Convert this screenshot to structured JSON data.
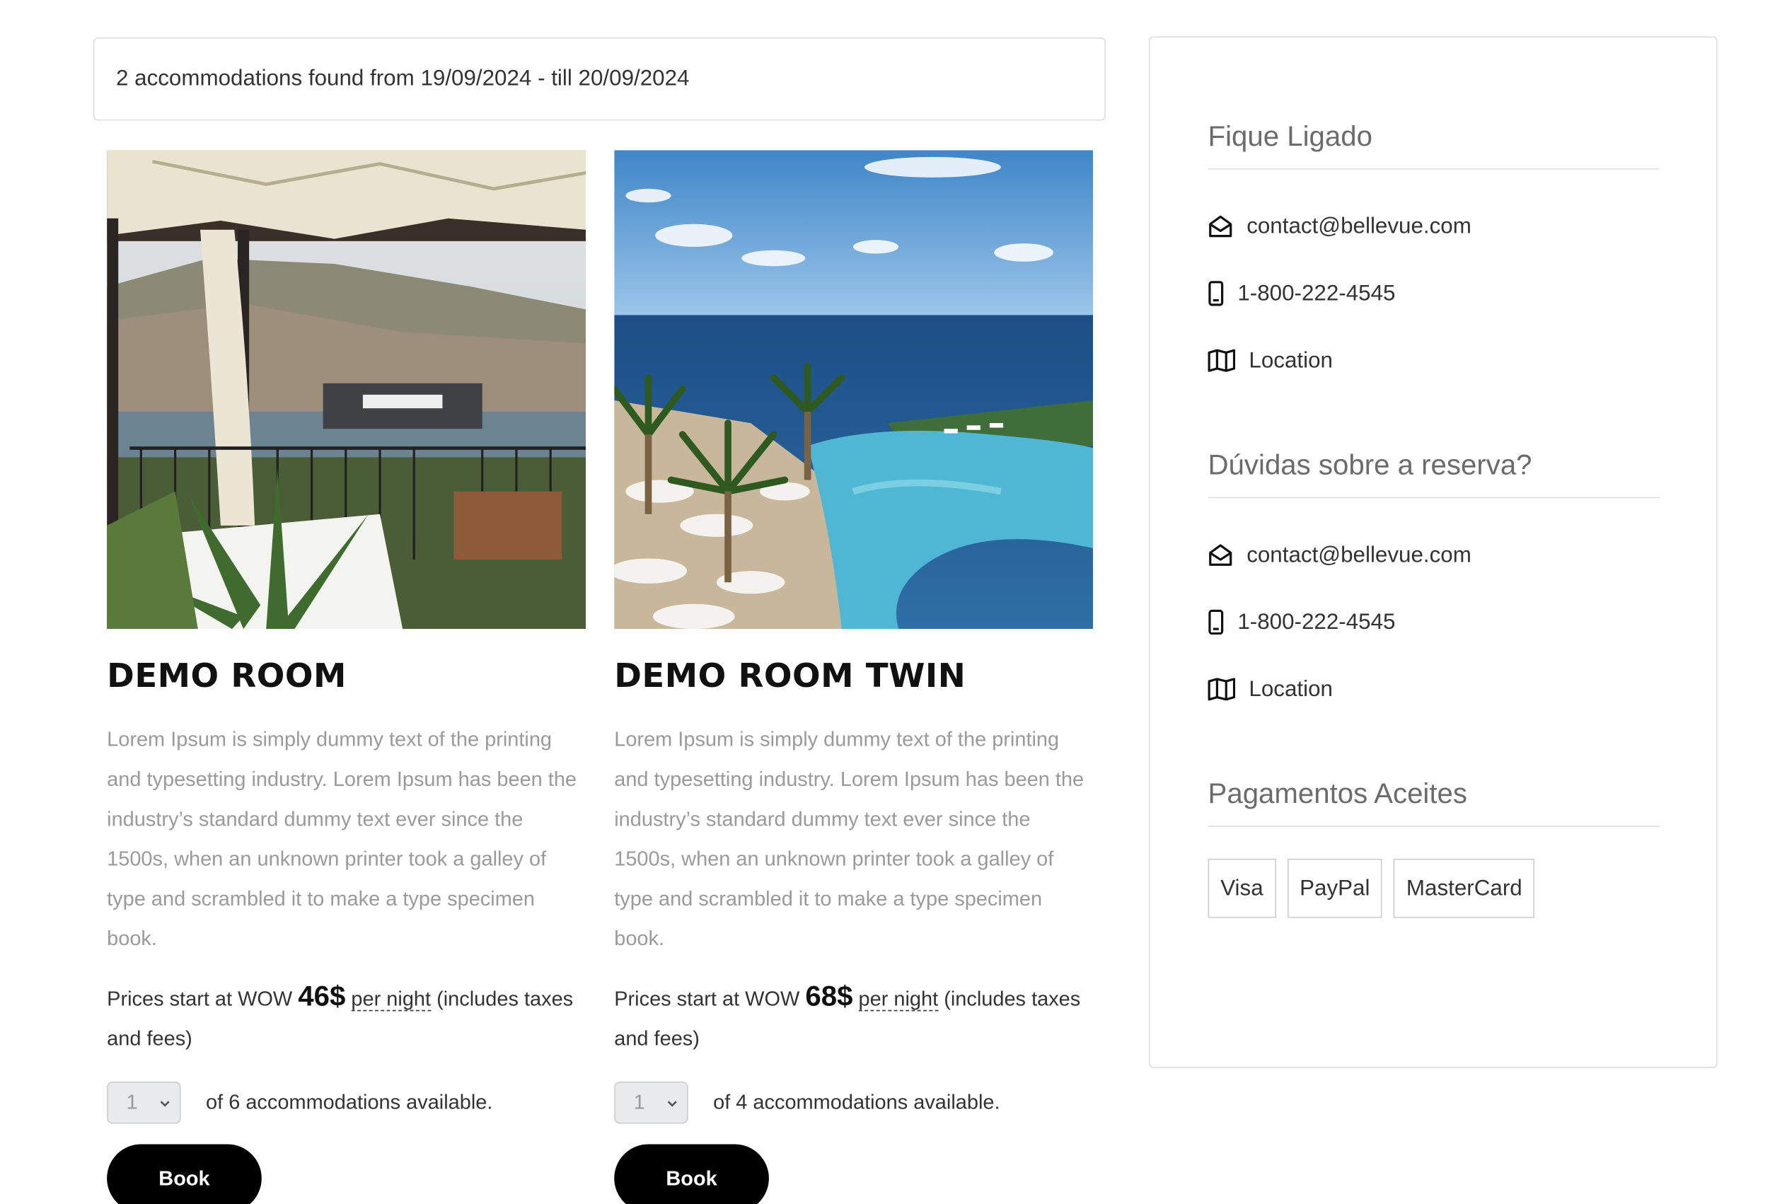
{
  "results": {
    "summary": "2 accommodations found from 19/09/2024 - till 20/09/2024"
  },
  "rooms": [
    {
      "title": "DEMO ROOM",
      "description": "Lorem Ipsum is simply dummy text of the printing and typesetting industry. Lorem Ipsum has been the industry’s standard dummy text ever since the 1500s, when an unknown printer took a galley of type and scrambled it to make a type specimen book.",
      "price_prefix": "Prices start at WOW ",
      "price": "46$",
      "per_night": "per night",
      "price_suffix": " (includes taxes and fees)",
      "qty": "1",
      "availability": "of 6 accommodations available.",
      "book_label": "Book"
    },
    {
      "title": "DEMO ROOM TWIN",
      "description": "Lorem Ipsum is simply dummy text of the printing and typesetting industry. Lorem Ipsum has been the industry’s standard dummy text ever since the 1500s, when an unknown printer took a galley of type and scrambled it to make a type specimen book.",
      "price_prefix": "Prices start at WOW ",
      "price": "68$",
      "per_night": "per night",
      "price_suffix": " (includes taxes and fees)",
      "qty": "1",
      "availability": "of 4 accommodations available.",
      "book_label": "Book"
    }
  ],
  "sidebar": {
    "stay_connected": {
      "heading": "Fique Ligado",
      "email": "contact@bellevue.com",
      "phone": "1-800-222-4545",
      "location": "Location"
    },
    "booking_questions": {
      "heading": "Dúvidas sobre a reserva?",
      "email": "contact@bellevue.com",
      "phone": "1-800-222-4545",
      "location": "Location"
    },
    "payments": {
      "heading": "Pagamentos Aceites",
      "methods": [
        "Visa",
        "PayPal",
        "MasterCard"
      ]
    }
  },
  "colors": {
    "button_bg": "#000000",
    "border": "#dddddd",
    "muted_text": "#9a9a9a",
    "heading_gray": "#6b6b6b"
  },
  "icons": {
    "email": "envelope-open-icon",
    "phone": "mobile-phone-icon",
    "location": "map-icon",
    "select": "chevron-down-icon"
  }
}
